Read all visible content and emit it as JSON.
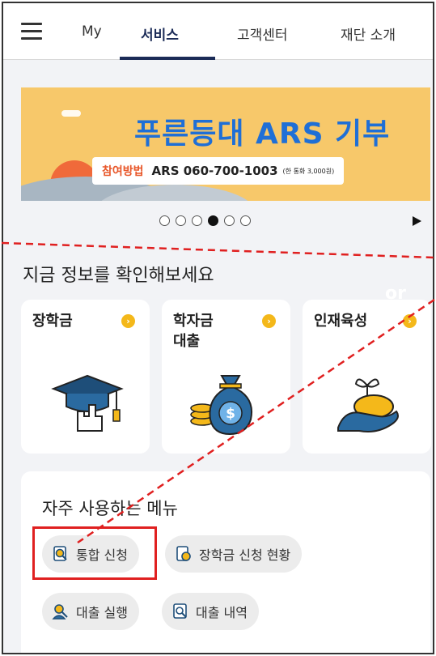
{
  "nav": {
    "tabs": [
      {
        "label": "My"
      },
      {
        "label": "서비스"
      },
      {
        "label": "고객센터"
      },
      {
        "label": "재단 소개"
      }
    ],
    "active_tab": "서비스"
  },
  "banner": {
    "title": "푸른등대 ARS 기부",
    "method_label": "참여방법",
    "phone": "ARS 060-700-1003",
    "note": "(한 통화 3,000원)",
    "slides_total": 6,
    "active_slide": 4
  },
  "info": {
    "title": "지금 정보를 확인해보세요",
    "cards": [
      {
        "label": "장학금",
        "icon": "graduation-cap-icon"
      },
      {
        "label": "학자금\n대출",
        "icon": "money-bag-icon"
      },
      {
        "label": "인재육성",
        "icon": "sprout-hand-icon"
      }
    ],
    "arrow": "›"
  },
  "menu": {
    "title": "자주 사용하는 메뉴",
    "items": [
      {
        "label": "통합 신청",
        "icon": "search-document-icon"
      },
      {
        "label": "장학금 신청 현황",
        "icon": "document-status-icon"
      },
      {
        "label": "대출 실행",
        "icon": "person-search-icon"
      },
      {
        "label": "대출 내역",
        "icon": "list-search-icon"
      }
    ]
  },
  "annotation": {
    "faint_text": "or",
    "highlight_color": "#e02020"
  },
  "colors": {
    "navy": "#1b2b57",
    "banner_bg": "#f7c86a",
    "banner_title": "#1f6fd6",
    "accent_yellow": "#f4b81a"
  }
}
